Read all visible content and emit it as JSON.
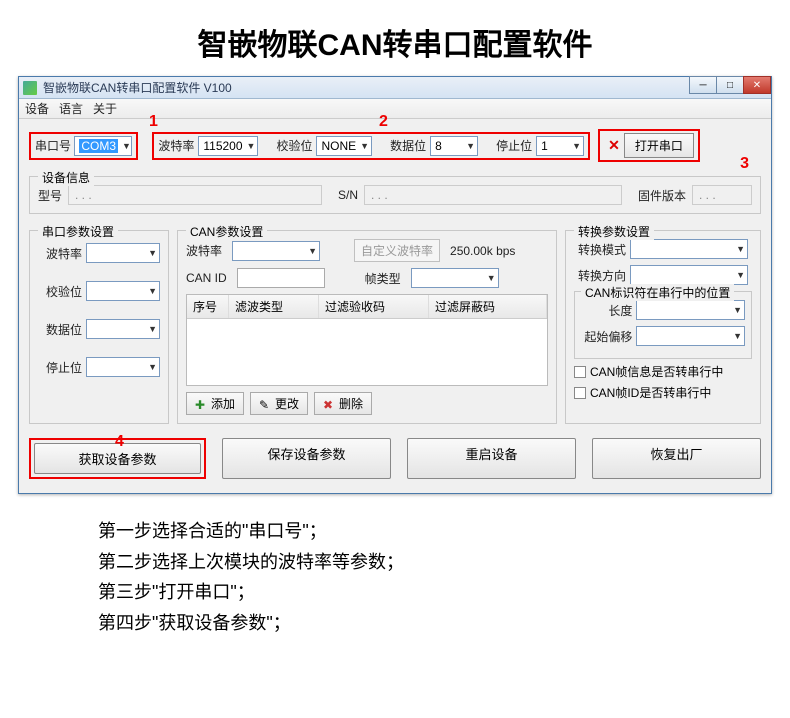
{
  "page_title": "智嵌物联CAN转串口配置软件",
  "window": {
    "title": "智嵌物联CAN转串口配置软件   V100"
  },
  "menu": {
    "device": "设备",
    "language": "语言",
    "about": "关于"
  },
  "markers": {
    "m1": "1",
    "m2": "2",
    "m3": "3",
    "m4": "4"
  },
  "top": {
    "port_label": "串口号",
    "port_value": "COM3",
    "baud_label": "波特率",
    "baud_value": "115200",
    "parity_label": "校验位",
    "parity_value": "NONE",
    "databits_label": "数据位",
    "databits_value": "8",
    "stopbits_label": "停止位",
    "stopbits_value": "1",
    "open_port": "打开串口"
  },
  "devinfo": {
    "title": "设备信息",
    "model_label": "型号",
    "model_value": ". . .",
    "sn_label": "S/N",
    "sn_value": ". . .",
    "fw_label": "固件版本",
    "fw_value": ". . ."
  },
  "serial": {
    "title": "串口参数设置",
    "baud": "波特率",
    "parity": "校验位",
    "databits": "数据位",
    "stopbits": "停止位"
  },
  "can": {
    "title": "CAN参数设置",
    "baud": "波特率",
    "custom_baud_label": "自定义波特率",
    "custom_baud_value": "250.00k bps",
    "can_id": "CAN ID",
    "frame_type": "帧类型",
    "cols": {
      "c1": "序号",
      "c2": "滤波类型",
      "c3": "过滤验收码",
      "c4": "过滤屏蔽码"
    },
    "btn_add": "添加",
    "btn_edit": "更改",
    "btn_del": "删除"
  },
  "conv": {
    "title": "转换参数设置",
    "mode": "转换模式",
    "direction": "转换方向",
    "pos_title": "CAN标识符在串行中的位置",
    "length": "长度",
    "offset": "起始偏移",
    "chk1": "CAN帧信息是否转串行中",
    "chk2": "CAN帧ID是否转串行中"
  },
  "bottom": {
    "get": "获取设备参数",
    "save": "保存设备参数",
    "restart": "重启设备",
    "factory": "恢复出厂"
  },
  "instructions": {
    "l1": "第一步选择合适的\"串口号\"；",
    "l2": "第二步选择上次模块的波特率等参数；",
    "l3": "第三步\"打开串口\"；",
    "l4": "第四步\"获取设备参数\"；"
  }
}
